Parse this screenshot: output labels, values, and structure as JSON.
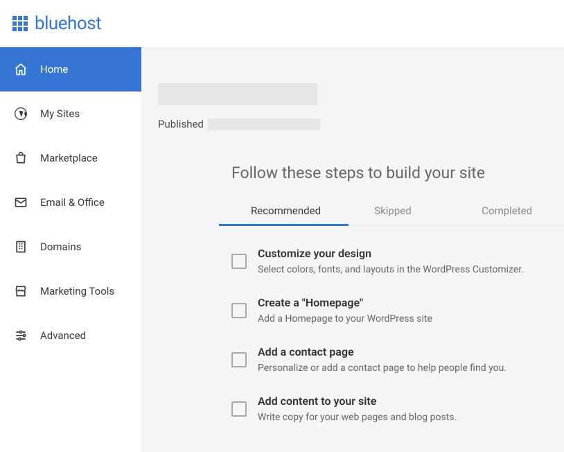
{
  "brand": "bluehost",
  "sidebar": {
    "items": [
      {
        "label": "Home"
      },
      {
        "label": "My Sites"
      },
      {
        "label": "Marketplace"
      },
      {
        "label": "Email & Office"
      },
      {
        "label": "Domains"
      },
      {
        "label": "Marketing Tools"
      },
      {
        "label": "Advanced"
      }
    ]
  },
  "main": {
    "published_label": "Published",
    "steps_heading": "Follow these steps to build your site",
    "tabs": [
      {
        "label": "Recommended"
      },
      {
        "label": "Skipped"
      },
      {
        "label": "Completed"
      }
    ],
    "tasks": [
      {
        "title": "Customize your design",
        "desc": "Select colors, fonts, and layouts in the WordPress Customizer."
      },
      {
        "title": "Create a \"Homepage\"",
        "desc": "Add a Homepage to your WordPress site"
      },
      {
        "title": "Add a contact page",
        "desc": "Personalize or add a contact page to help people find you."
      },
      {
        "title": "Add content to your site",
        "desc": "Write copy for your web pages and blog posts."
      }
    ]
  }
}
